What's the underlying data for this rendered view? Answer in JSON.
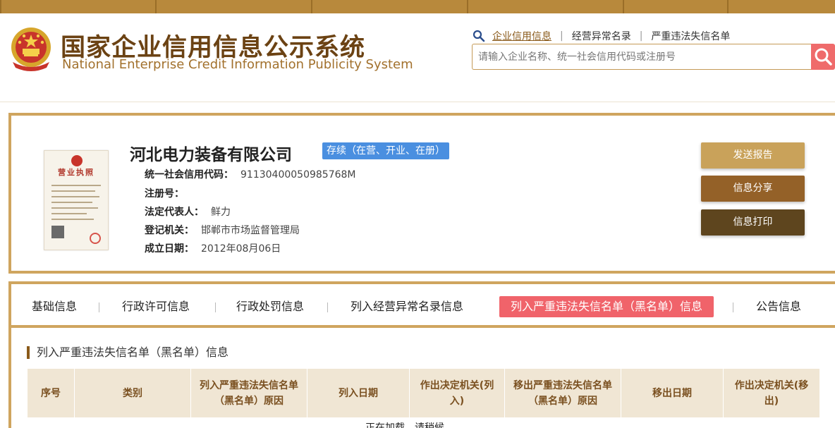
{
  "header": {
    "title_cn": "国家企业信用信息公示系统",
    "title_en": "National Enterprise Credit Information Publicity System",
    "search_links": [
      {
        "label": "企业信用信息"
      },
      {
        "label": "经营异常名录"
      },
      {
        "label": "严重违法失信名单"
      }
    ],
    "search_placeholder": "请输入企业名称、统一社会信用代码或注册号"
  },
  "company": {
    "name": "河北电力装备有限公司",
    "status": "存续（在营、开业、在册）",
    "license_title": "营业执照",
    "fields": [
      {
        "label": "统一社会信用代码：",
        "value": "91130400050985768M"
      },
      {
        "label": "注册号：",
        "value": ""
      },
      {
        "label": "法定代表人：",
        "value": "鲜力"
      },
      {
        "label": "登记机关：",
        "value": "邯郸市市场监督管理局"
      },
      {
        "label": "成立日期：",
        "value": "2012年08月06日"
      }
    ],
    "actions": {
      "report": "发送报告",
      "share": "信息分享",
      "print": "信息打印"
    }
  },
  "tabs": [
    {
      "label": "基础信息"
    },
    {
      "label": "行政许可信息"
    },
    {
      "label": "行政处罚信息"
    },
    {
      "label": "列入经营异常名录信息"
    },
    {
      "label": "列入严重违法失信名单（黑名单）信息"
    },
    {
      "label": "公告信息"
    }
  ],
  "section": {
    "title": "列入严重违法失信名单（黑名单）信息",
    "columns": [
      "序号",
      "类别",
      "列入严重违法失信名单（黑名单）原因",
      "列入日期",
      "作出决定机关(列入)",
      "移出严重违法失信名单（黑名单）原因",
      "移出日期",
      "作出决定机关(移出)"
    ],
    "loading_text": "正在加载，请稍候..."
  },
  "colors": {
    "gold": "#cfa55f",
    "brown": "#6b4213",
    "active_tab": "#f0636a",
    "status_blue": "#4a8fe0"
  }
}
